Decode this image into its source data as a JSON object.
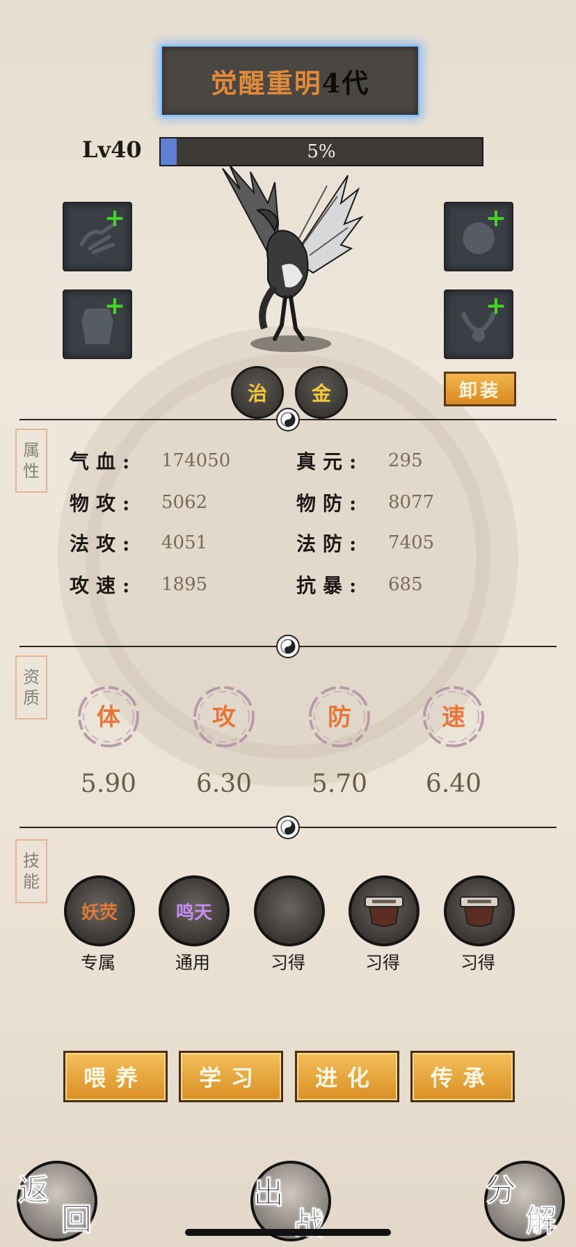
{
  "title": {
    "name": "觉醒重明",
    "generation": "4代"
  },
  "level": {
    "label": "Lv40",
    "progress_text": "5%",
    "progress": 0.05
  },
  "badges": [
    "治",
    "金"
  ],
  "unequip_label": "卸装",
  "sections": {
    "attributes": "属性",
    "aptitude": "资质",
    "skills": "技能"
  },
  "stats": {
    "left": [
      {
        "key": "气血:",
        "value": "174050"
      },
      {
        "key": "物攻:",
        "value": "5062"
      },
      {
        "key": "法攻:",
        "value": "4051"
      },
      {
        "key": "攻速:",
        "value": "1895"
      }
    ],
    "right": [
      {
        "key": "真元:",
        "value": "295"
      },
      {
        "key": "物防:",
        "value": "8077"
      },
      {
        "key": "法防:",
        "value": "7405"
      },
      {
        "key": "抗暴:",
        "value": "685"
      }
    ]
  },
  "qualities": [
    {
      "label": "体",
      "value": "5.90"
    },
    {
      "label": "攻",
      "value": "6.30"
    },
    {
      "label": "防",
      "value": "5.70"
    },
    {
      "label": "速",
      "value": "6.40"
    }
  ],
  "skills": [
    {
      "name": "妖荧",
      "type": "专属",
      "color": "#e07a3a"
    },
    {
      "name": "鸣天",
      "type": "通用",
      "color": "#c58ef0"
    },
    {
      "name": "",
      "type": "习得",
      "color": ""
    },
    {
      "name": "",
      "type": "习得",
      "color": ""
    },
    {
      "name": "",
      "type": "习得",
      "color": ""
    }
  ],
  "actions": [
    "喂养",
    "学习",
    "进化",
    "传承"
  ],
  "nav": {
    "back": [
      "返",
      "回"
    ],
    "battle": [
      "出",
      "战"
    ],
    "decompose": [
      "分",
      "解"
    ]
  },
  "colors": {
    "accent_orange": "#e08a3c",
    "badge_gold": "#f6c93a",
    "plus_green": "#43d12a",
    "quality_orange": "#e8763a"
  }
}
